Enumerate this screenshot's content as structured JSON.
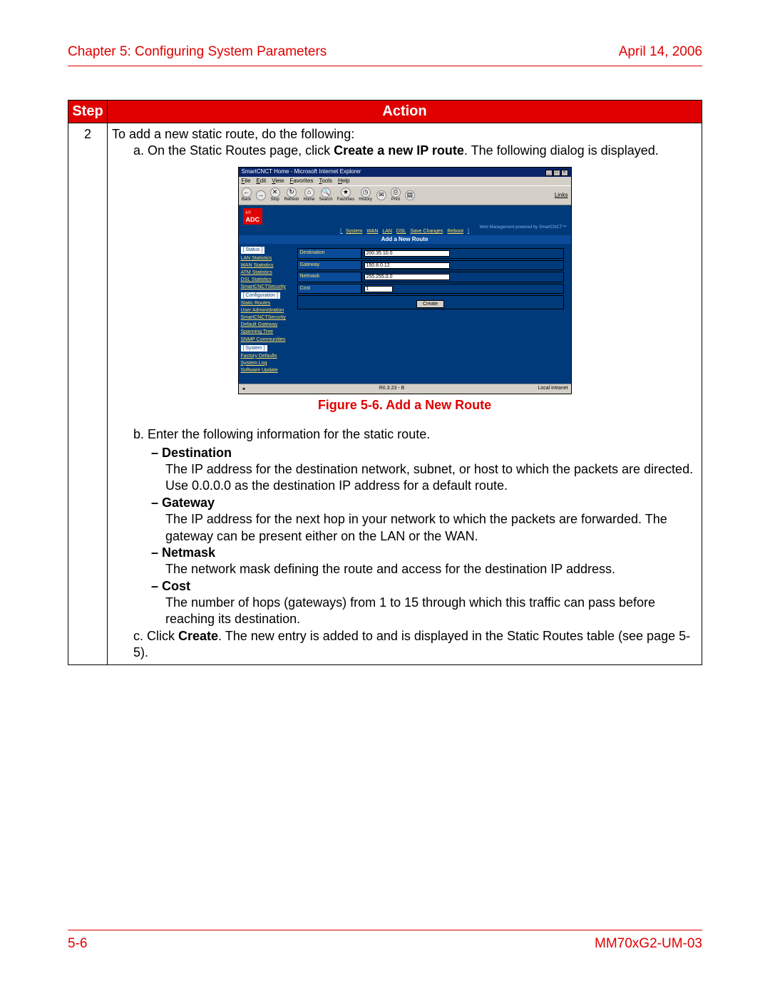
{
  "header": {
    "chapter": "Chapter 5: Configuring System Parameters",
    "date": "April 14, 2006"
  },
  "footer": {
    "page": "5-6",
    "doc_id": "MM70xG2-UM-03"
  },
  "table": {
    "head_step": "Step",
    "head_action": "Action",
    "step_num": "2",
    "intro": "To add a new static route, do the following:",
    "step_a_prefix": "a. On the Static Routes page, click ",
    "step_a_bold": "Create a new IP route",
    "step_a_suffix": ". The following dialog is displayed.",
    "figure_caption": "Figure 5-6. Add a New Route",
    "step_b": "b. Enter the following information for the static route.",
    "fields": {
      "destination": {
        "label": "– Destination",
        "desc1": "The IP address for the destination network, subnet, or host to which the packets are directed.",
        "desc2": "Use 0.0.0.0 as the destination IP address for a default route."
      },
      "gateway": {
        "label": "– Gateway",
        "desc": "The IP address for the next hop in your network to which the packets are forwarded. The gateway can be present either on the LAN or the WAN."
      },
      "netmask": {
        "label": "– Netmask",
        "desc": "The network mask defining the route and access for the destination IP address."
      },
      "cost": {
        "label": "– Cost",
        "desc": "The number of hops (gateways) from 1 to 15 through which this traffic can pass before reaching its destination."
      }
    },
    "step_c_prefix": "c. Click ",
    "step_c_bold": "Create",
    "step_c_suffix": ". The new entry is added to and is displayed in the Static Routes table (see page 5-5)."
  },
  "browser": {
    "title": "SmartCNCT Home - Microsoft Internet Explorer",
    "menu": [
      "File",
      "Edit",
      "View",
      "Favorites",
      "Tools",
      "Help"
    ],
    "toolbar": [
      "Back",
      "",
      "Stop",
      "Refresh",
      "Home",
      "Search",
      "Favorites",
      "History",
      "",
      "Print",
      ""
    ],
    "links_label": "Links",
    "logo_pre": "///",
    "logo": "ADC",
    "top_right": "Web Management powered by SmartCNCT™",
    "navbar_bracket_open": "[ ",
    "navbar_bracket_close": " ]",
    "navbar": [
      "System",
      "WAN",
      "LAN",
      "DSL",
      "Save Changes",
      "Reboot"
    ],
    "section_title": "Add a New Route",
    "sidebar": {
      "status_cat": "[ Status ]",
      "status_items": [
        "LAN Statistics",
        "WAN Statistics",
        "ATM Statistics",
        "DSL Statistics",
        "SmartCNCTSecurity"
      ],
      "config_cat": "[ Configuration ]",
      "config_items": [
        "Static Routes",
        "User Administration",
        "SmartCNCTSecurity",
        "Default Gateway",
        "Spanning Tree",
        "SNMP Communities"
      ],
      "system_cat": "[ System ]",
      "system_items": [
        "Factory Defaults",
        "System Log",
        "Software Update"
      ]
    },
    "form": {
      "destination_label": "Destination",
      "destination_val": "200.35.10.0",
      "gateway_label": "Gateway",
      "gateway_val": "150.8.0.12",
      "netmask_label": "Netmask",
      "netmask_val": "255.255.0.0",
      "cost_label": "Cost",
      "cost_val": "1",
      "create_btn": "Create"
    },
    "status_mid": "R0.3.23 - B",
    "status_right": "Local intranet"
  }
}
